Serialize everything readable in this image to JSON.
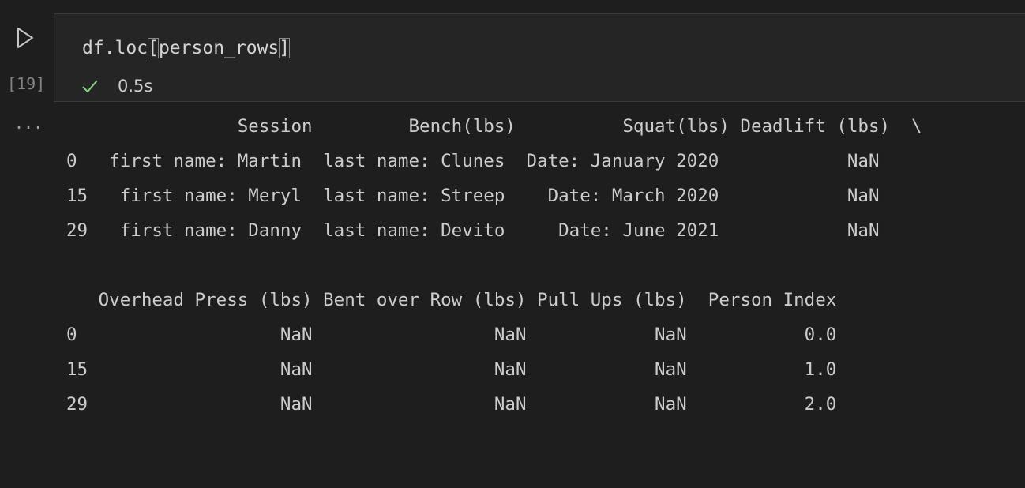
{
  "cell": {
    "execution_count": "[19]",
    "code": {
      "prefix": "df.loc",
      "open_bracket": "[",
      "argument": "person_rows",
      "close_bracket": "]"
    },
    "status": {
      "icon": "checkmark-icon",
      "time": "0.5s"
    },
    "colors": {
      "success_check": "#89d185",
      "run_icon": "#c5c5c5"
    }
  },
  "output": {
    "ellipsis": "...",
    "lines": [
      "                Session         Bench(lbs)          Squat(lbs) Deadlift (lbs)  \\",
      "0   first name: Martin  last name: Clunes  Date: January 2020            NaN",
      "15   first name: Meryl  last name: Streep    Date: March 2020            NaN",
      "29   first name: Danny  last name: Devito     Date: June 2021            NaN",
      "",
      "   Overhead Press (lbs) Bent over Row (lbs) Pull Ups (lbs)  Person Index",
      "0                   NaN                 NaN            NaN           0.0",
      "15                  NaN                 NaN            NaN           1.0",
      "29                  NaN                 NaN            NaN           2.0"
    ]
  }
}
